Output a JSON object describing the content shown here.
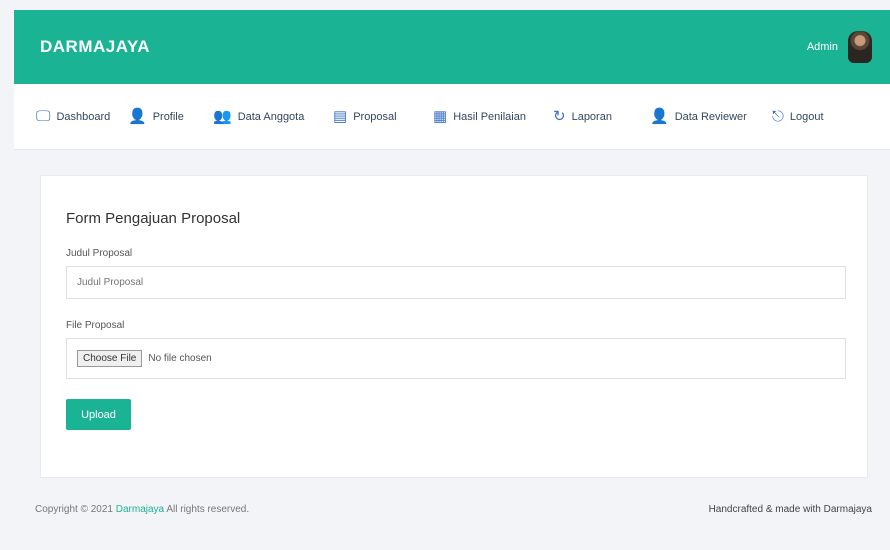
{
  "header": {
    "brand": "DARMAJAYA",
    "user_name": "Admin"
  },
  "nav": {
    "items": [
      {
        "label": "Dashboard",
        "icon": "monitor-icon",
        "glyph": "🖵"
      },
      {
        "label": "Profile",
        "icon": "user-icon",
        "glyph": "👤"
      },
      {
        "label": "Data Anggota",
        "icon": "users-icon",
        "glyph": "👥"
      },
      {
        "label": "Proposal",
        "icon": "document-icon",
        "glyph": "▤"
      },
      {
        "label": "Hasil Penilaian",
        "icon": "report-icon",
        "glyph": "▦"
      },
      {
        "label": "Laporan",
        "icon": "history-icon",
        "glyph": "↻"
      },
      {
        "label": "Data Reviewer",
        "icon": "reviewer-icon",
        "glyph": "👤"
      },
      {
        "label": "Logout",
        "icon": "logout-icon",
        "glyph": "⎋"
      }
    ]
  },
  "form": {
    "title": "Form Pengajuan Proposal",
    "judul_label": "Judul Proposal",
    "judul_placeholder": "Judul Proposal",
    "file_label": "File Proposal",
    "file_button": "Choose File",
    "file_status": "No file chosen",
    "submit_label": "Upload"
  },
  "footer": {
    "copyright": "Copyright © 2021",
    "copyright_link": "Darmajaya",
    "copyright_rest": "All rights reserved.",
    "credit": "Handcrafted & made with Darmajaya"
  },
  "colors": {
    "accent": "#1ab394",
    "nav_icon": "#3a6fc8"
  }
}
